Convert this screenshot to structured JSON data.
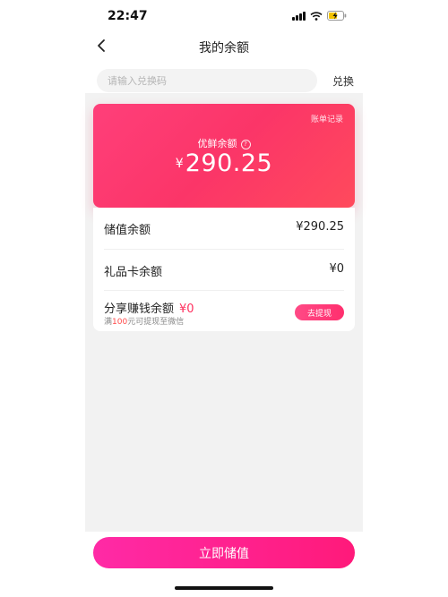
{
  "status_bar": {
    "time": "22:47",
    "icons": [
      "signal-icon",
      "wifi-icon",
      "battery-charging-icon"
    ]
  },
  "nav": {
    "back_icon": "chevron-left-icon",
    "title": "我的余额"
  },
  "redeem": {
    "placeholder": "请输入兑换码",
    "button_label": "兑换"
  },
  "balance_card": {
    "bill_link": "账单记录",
    "label": "优鲜余额",
    "help_icon": "question-circle-icon",
    "help_glyph": "?",
    "currency": "¥",
    "amount": "290.25",
    "gradient": [
      "#ff3f7a",
      "#ff4a5c"
    ]
  },
  "balances": {
    "stored_value": {
      "label": "储值余额",
      "value": "¥290.25"
    },
    "gift_card": {
      "label": "礼品卡余额",
      "value": "¥0"
    },
    "share_earnings": {
      "label": "分享赚钱余额",
      "value": "¥0",
      "note_prefix": "满",
      "note_highlight": "100",
      "note_suffix": "元可提现至微信",
      "withdraw_label": "去提现"
    }
  },
  "footer": {
    "recharge_label": "立即储值"
  },
  "colors": {
    "accent": "#ff2f6e",
    "button": "#ff1a8c",
    "background": "#f2f2f2"
  }
}
